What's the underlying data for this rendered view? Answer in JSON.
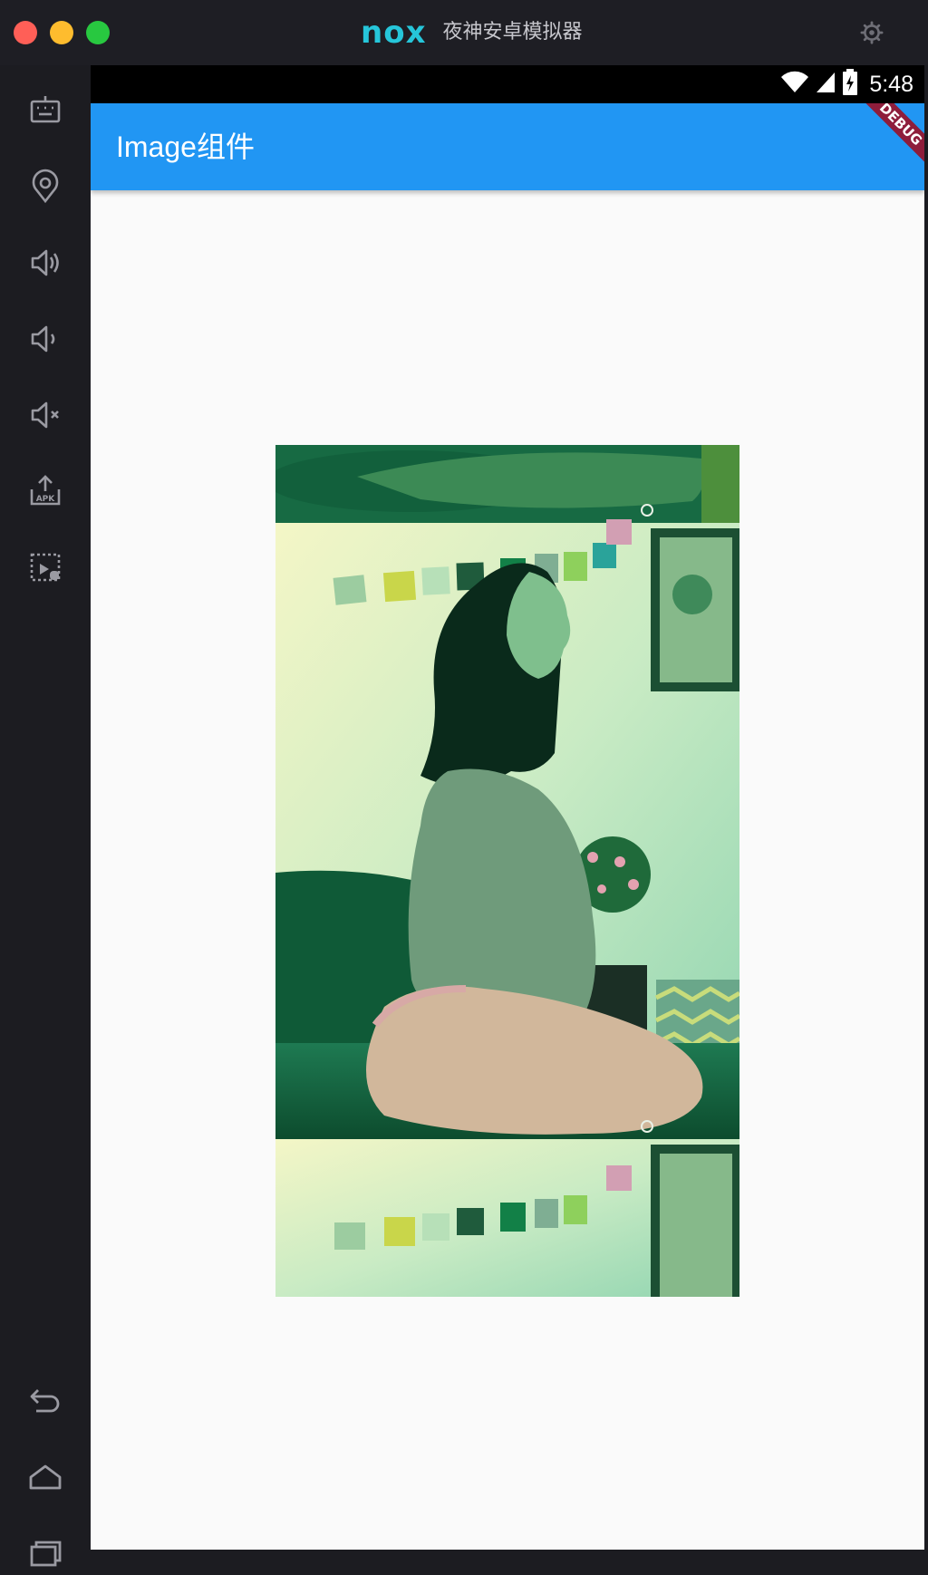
{
  "window": {
    "brand_logo": "nox",
    "title": "夜神安卓模拟器"
  },
  "status_bar": {
    "time": "5:48"
  },
  "app_bar": {
    "title": "Image组件",
    "debug_banner": "DEBUG"
  },
  "sidebar": {
    "icons": [
      "keyboard-icon",
      "location-icon",
      "volume-up-icon",
      "volume-down-icon",
      "volume-mute-icon",
      "apk-install-icon",
      "screen-record-icon"
    ],
    "nav_icons": [
      "back-icon",
      "home-icon",
      "recents-icon"
    ]
  },
  "colors": {
    "app_bar": "#2196f3",
    "brand": "#26c6da",
    "frame": "#1c1c21",
    "screen_bg": "#fafafa"
  }
}
